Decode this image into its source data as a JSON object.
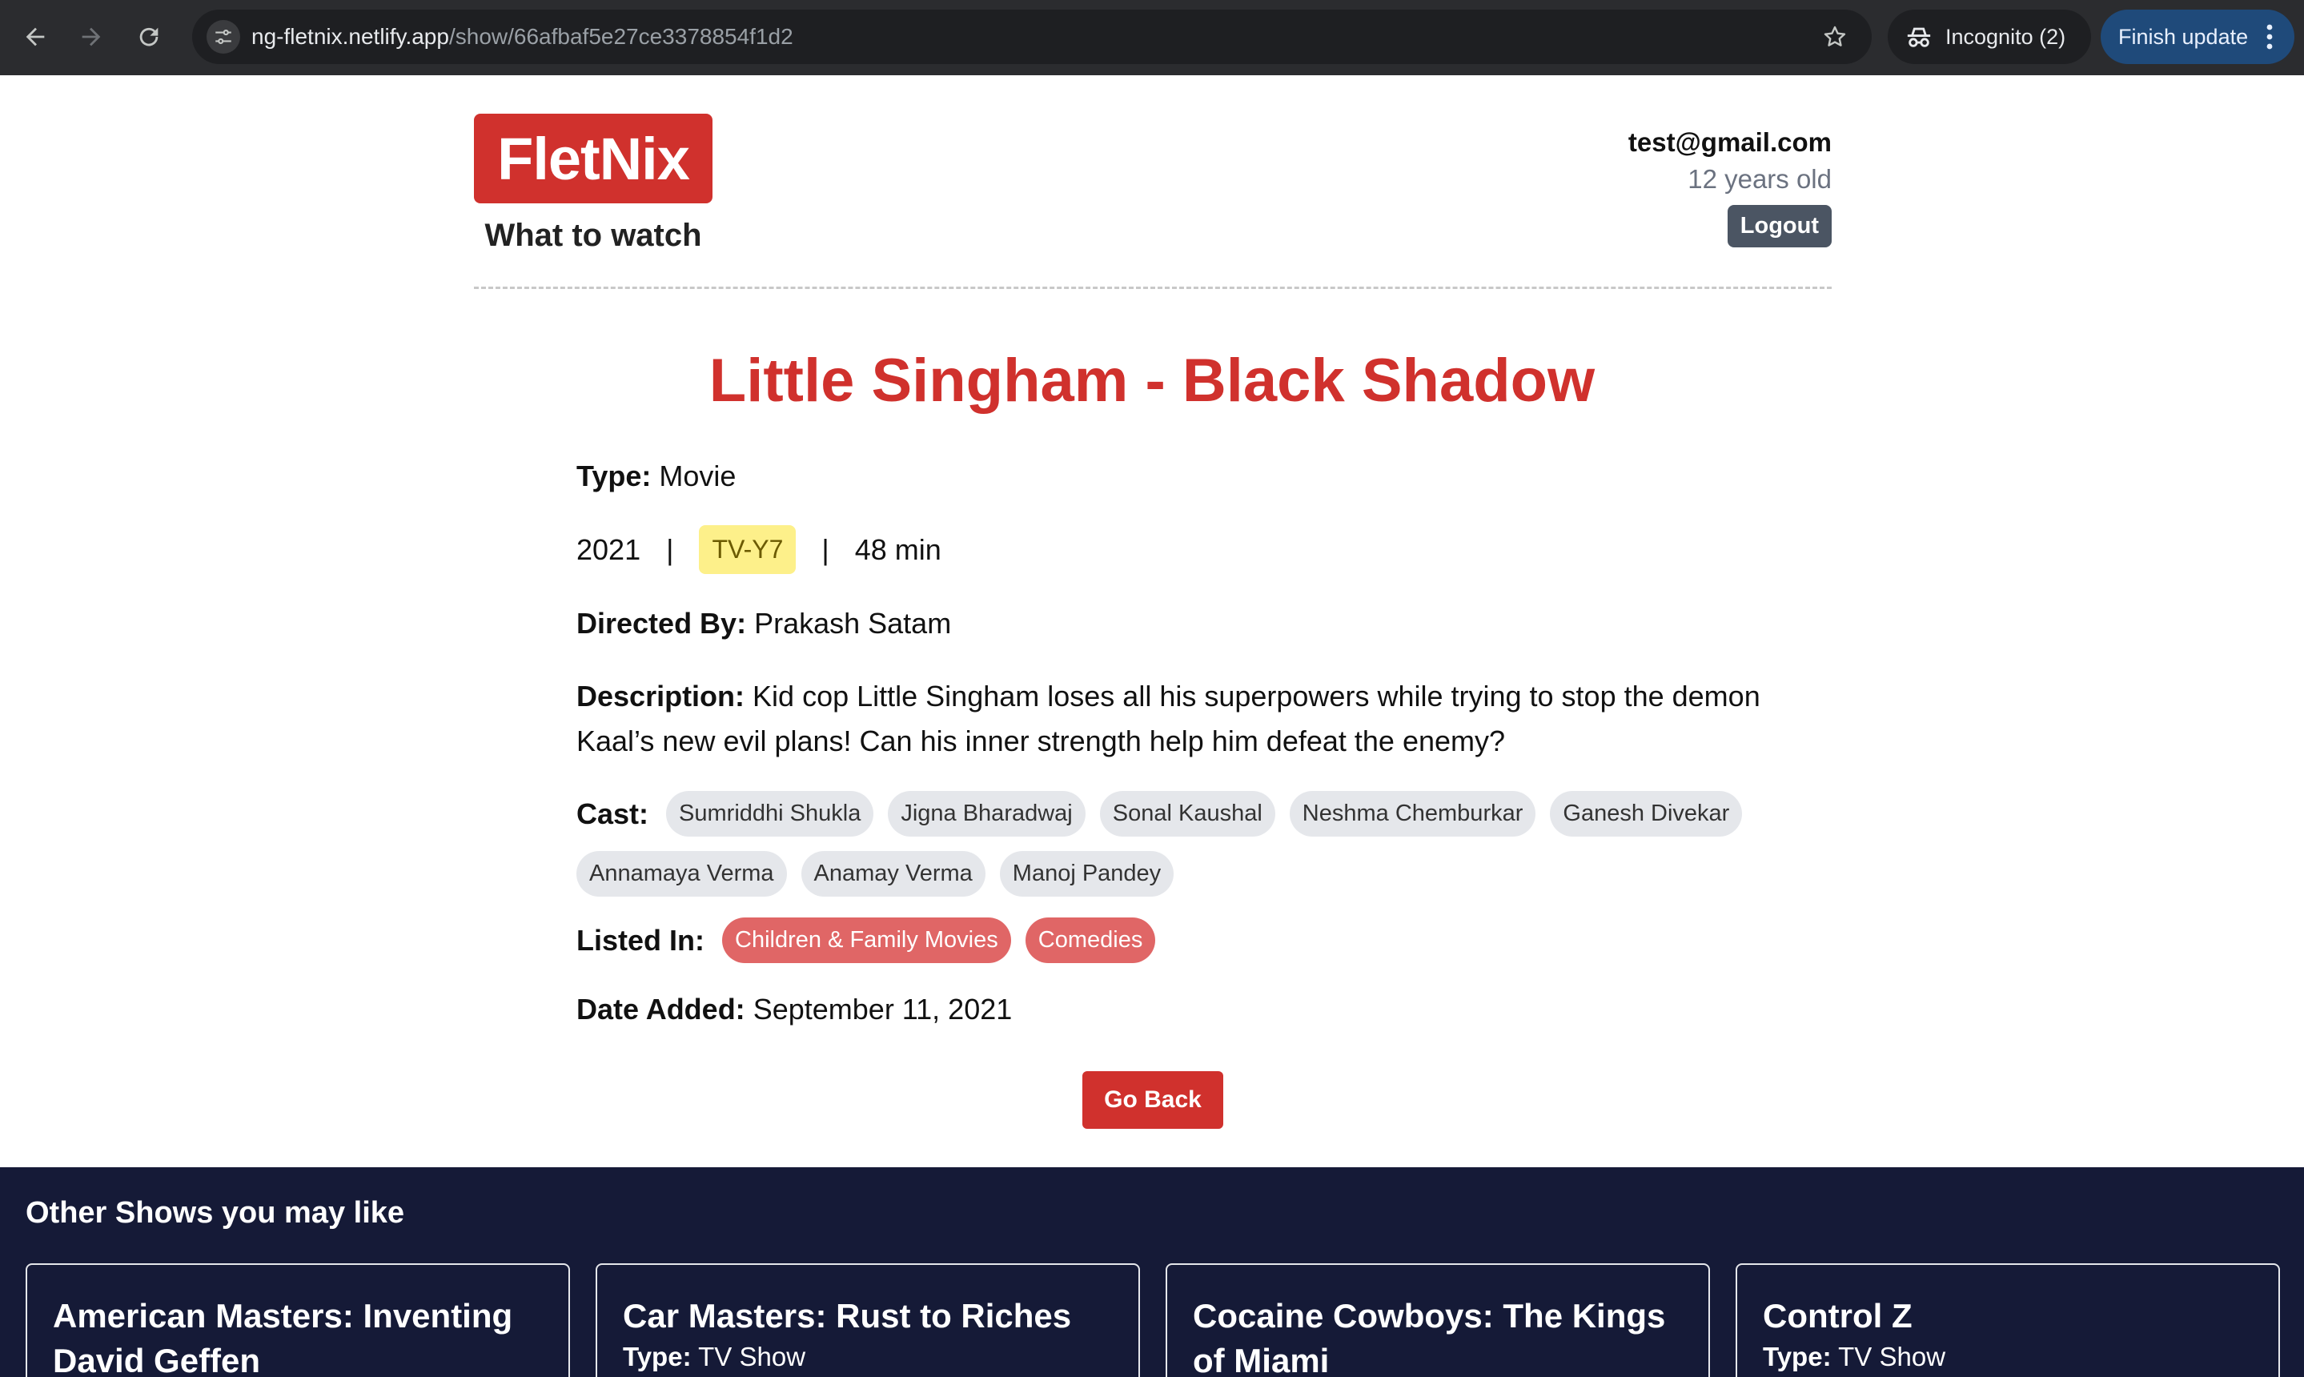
{
  "browser": {
    "url_host": "ng-fletnix.netlify.app",
    "url_path": "/show/66afbaf5e27ce3378854f1d2",
    "incognito_label": "Incognito (2)",
    "update_label": "Finish update"
  },
  "header": {
    "logo": "FletNix",
    "tagline": "What to watch",
    "user_email": "test@gmail.com",
    "user_age": "12 years old",
    "logout_label": "Logout"
  },
  "show": {
    "title": "Little Singham - Black Shadow",
    "type_label": "Type:",
    "type": "Movie",
    "year": "2021",
    "separator": "|",
    "rating": "TV-Y7",
    "duration": "48 min",
    "director_label": "Directed By:",
    "director": "Prakash Satam",
    "description_label": "Description:",
    "description": "Kid cop Little Singham loses all his superpowers while trying to stop the demon Kaal’s new evil plans! Can his inner strength help him defeat the enemy?",
    "cast_label": "Cast:",
    "cast": [
      "Sumriddhi Shukla",
      "Jigna Bharadwaj",
      "Sonal Kaushal",
      "Neshma Chemburkar",
      "Ganesh Divekar",
      "Annamaya Verma",
      "Anamay Verma",
      "Manoj Pandey"
    ],
    "listed_in_label": "Listed In:",
    "listed_in": [
      "Children & Family Movies",
      "Comedies"
    ],
    "date_added_label": "Date Added:",
    "date_added": "September 11, 2021",
    "go_back_label": "Go Back"
  },
  "others": {
    "title": "Other Shows you may like",
    "type_label": "Type:",
    "cards": [
      {
        "title": "American Masters: Inventing David Geffen",
        "type": ""
      },
      {
        "title": "Car Masters: Rust to Riches",
        "type": "TV Show"
      },
      {
        "title": "Cocaine Cowboys: The Kings of Miami",
        "type": ""
      },
      {
        "title": "Control Z",
        "type": "TV Show"
      }
    ]
  },
  "colors": {
    "brand_red": "#d0312d",
    "footer_navy": "#151a37",
    "rating_yellow": "#fdf08a",
    "genre_chip": "#e06666"
  },
  "icons": [
    "back-arrow-icon",
    "forward-arrow-icon",
    "reload-icon",
    "site-settings-icon",
    "bookmark-star-icon",
    "incognito-icon",
    "more-vert-icon"
  ]
}
